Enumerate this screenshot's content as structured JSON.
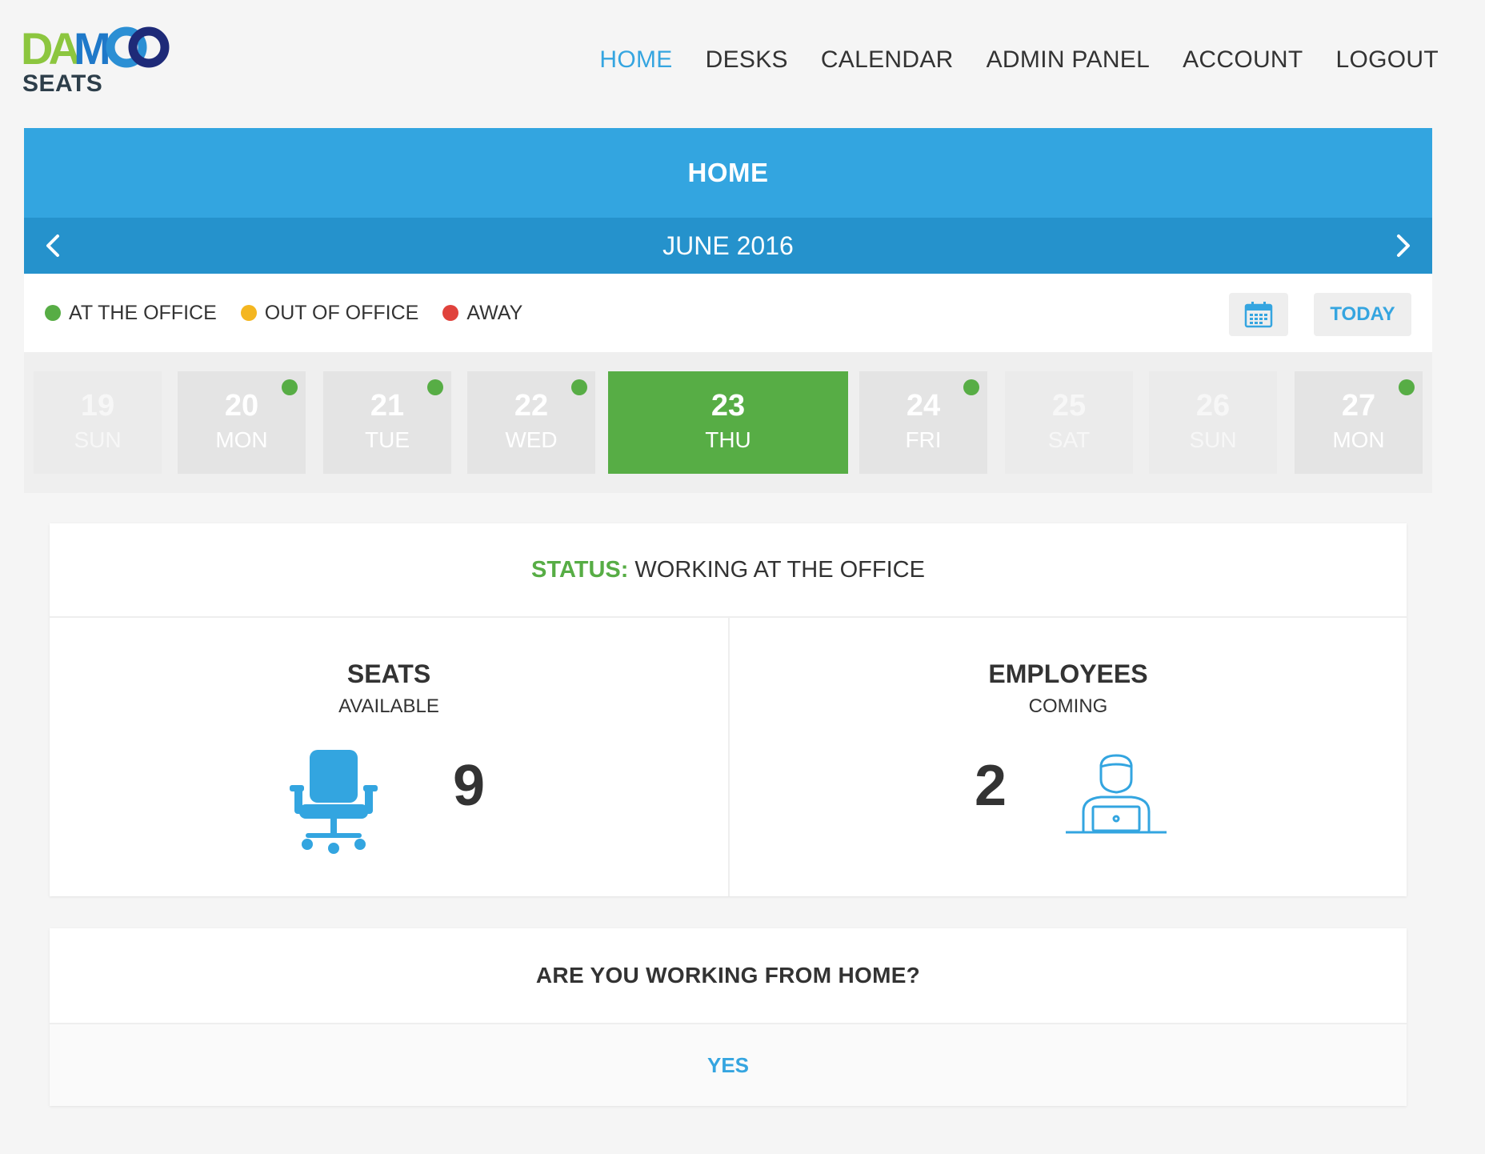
{
  "brand": {
    "logo_text": "DAMCO",
    "sub": "SEATS",
    "colors": {
      "green": "#8cc63f",
      "blue": "#1f79c9",
      "navy": "#1e2a78"
    }
  },
  "nav": {
    "items": [
      "HOME",
      "DESKS",
      "CALENDAR",
      "ADMIN PANEL",
      "ACCOUNT",
      "LOGOUT"
    ],
    "active": "HOME"
  },
  "panel": {
    "title": "HOME",
    "month": "JUNE 2016",
    "prev_icon": "chevron-left-icon",
    "next_icon": "chevron-right-icon"
  },
  "legend": [
    {
      "label": "AT THE OFFICE",
      "color": "#57ad45"
    },
    {
      "label": "OUT OF OFFICE",
      "color": "#f4b620"
    },
    {
      "label": "AWAY",
      "color": "#e0423c"
    }
  ],
  "calendar_button_icon": "calendar-icon",
  "today_label": "TODAY",
  "days": [
    {
      "num": "19",
      "dow": "SUN",
      "state": "faded",
      "indicator": false
    },
    {
      "num": "20",
      "dow": "MON",
      "state": "normal",
      "indicator": true
    },
    {
      "num": "21",
      "dow": "TUE",
      "state": "normal",
      "indicator": true
    },
    {
      "num": "22",
      "dow": "WED",
      "state": "normal",
      "indicator": true
    },
    {
      "num": "23",
      "dow": "THU",
      "state": "selected",
      "indicator": false
    },
    {
      "num": "24",
      "dow": "FRI",
      "state": "normal",
      "indicator": true
    },
    {
      "num": "25",
      "dow": "SAT",
      "state": "faded",
      "indicator": false
    },
    {
      "num": "26",
      "dow": "SUN",
      "state": "faded",
      "indicator": false
    },
    {
      "num": "27",
      "dow": "MON",
      "state": "normal",
      "indicator": true
    }
  ],
  "status": {
    "label": "STATUS:",
    "value": "WORKING AT THE OFFICE"
  },
  "seats": {
    "title": "SEATS",
    "subtitle": "AVAILABLE",
    "count": "9",
    "icon": "office-chair-icon"
  },
  "employees": {
    "title": "EMPLOYEES",
    "subtitle": "COMING",
    "count": "2",
    "icon": "employee-laptop-icon"
  },
  "wfh": {
    "question": "ARE YOU WORKING FROM HOME?",
    "answer": "YES"
  }
}
